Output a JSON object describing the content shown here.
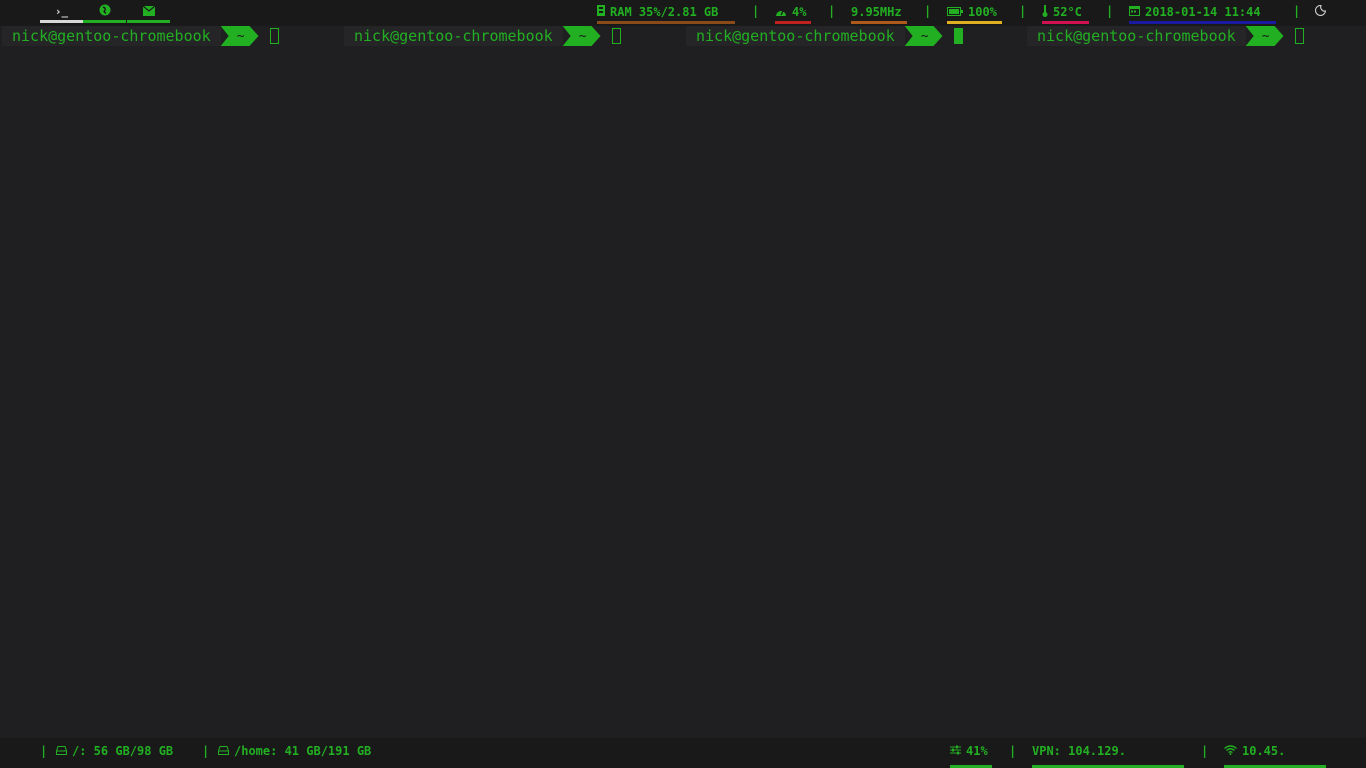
{
  "topbar": {
    "workspaces": [
      {
        "icon": "terminal-icon",
        "glyph": "›_",
        "color": "#e0e0e0",
        "underline": "#d8d8d8"
      },
      {
        "icon": "firefox-icon",
        "glyph": "●",
        "color": "#22b022",
        "underline": "#22b022"
      },
      {
        "icon": "mail-icon",
        "glyph": "✉",
        "color": "#22b022",
        "underline": "#22b022"
      }
    ],
    "ram": {
      "icon": "memory-icon",
      "text": "RAM 35%/2.81 GB",
      "underline": "#8a4a1a"
    },
    "cpu": {
      "icon": "gauge-icon",
      "text": "4%",
      "underline": "#c02020"
    },
    "freq": {
      "text": "9.95MHz",
      "underline": "#b05a1a"
    },
    "battery": {
      "icon": "battery-icon",
      "text": "100%",
      "underline": "#e0b020"
    },
    "temp": {
      "icon": "thermometer-icon",
      "text": "52°C",
      "underline": "#d01050"
    },
    "date": {
      "icon": "calendar-icon",
      "text": "2018-01-14 11:44",
      "underline": "#1a1aa0"
    },
    "power": {
      "icon": "moon-icon"
    },
    "separator": "|"
  },
  "panes": [
    {
      "user": "nick@gentoo-chromebook",
      "dir": "~",
      "active": false
    },
    {
      "user": "nick@gentoo-chromebook",
      "dir": "~",
      "active": false
    },
    {
      "user": "nick@gentoo-chromebook",
      "dir": "~",
      "active": true
    },
    {
      "user": "nick@gentoo-chromebook",
      "dir": "~",
      "active": false
    }
  ],
  "bottombar": {
    "root_fs": {
      "icon": "disk-icon",
      "text": "/: 56 GB/98 GB"
    },
    "home_fs": {
      "icon": "disk-icon",
      "text": "/home: 41 GB/191 GB"
    },
    "volume": {
      "icon": "sliders-icon",
      "text": "41%",
      "underline": "#22b022"
    },
    "vpn": {
      "text": "VPN: 104.129.",
      "underline": "#22b022"
    },
    "wifi": {
      "icon": "wifi-icon",
      "text": "10.45.",
      "underline": "#22b022"
    },
    "separator": "|"
  }
}
